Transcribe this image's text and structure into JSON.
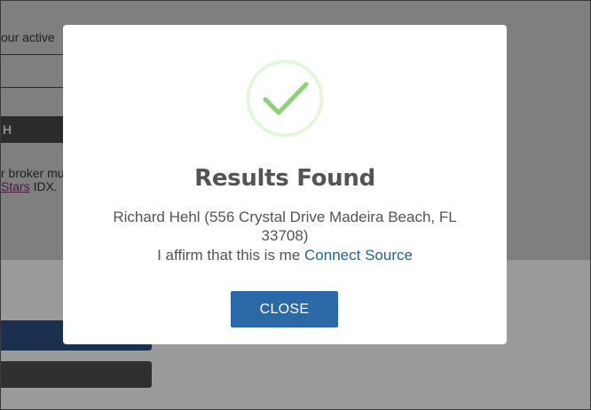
{
  "background": {
    "active_text": "our active",
    "search_bar_label": "H",
    "broker_text": "r broker mu",
    "idx_link": "Stars",
    "idx_suffix": " IDX."
  },
  "modal": {
    "icon": "checkmark-icon",
    "title": "Results Found",
    "result": "Richard Hehl (556 Crystal Drive Madeira Beach, FL 33708)",
    "affirm_text": "I affirm that this is me",
    "affirm_link": "Connect Source",
    "close_label": "CLOSE"
  },
  "colors": {
    "accent_button": "#2a69a5",
    "link": "#23648f",
    "check_green": "#8fd07a"
  }
}
